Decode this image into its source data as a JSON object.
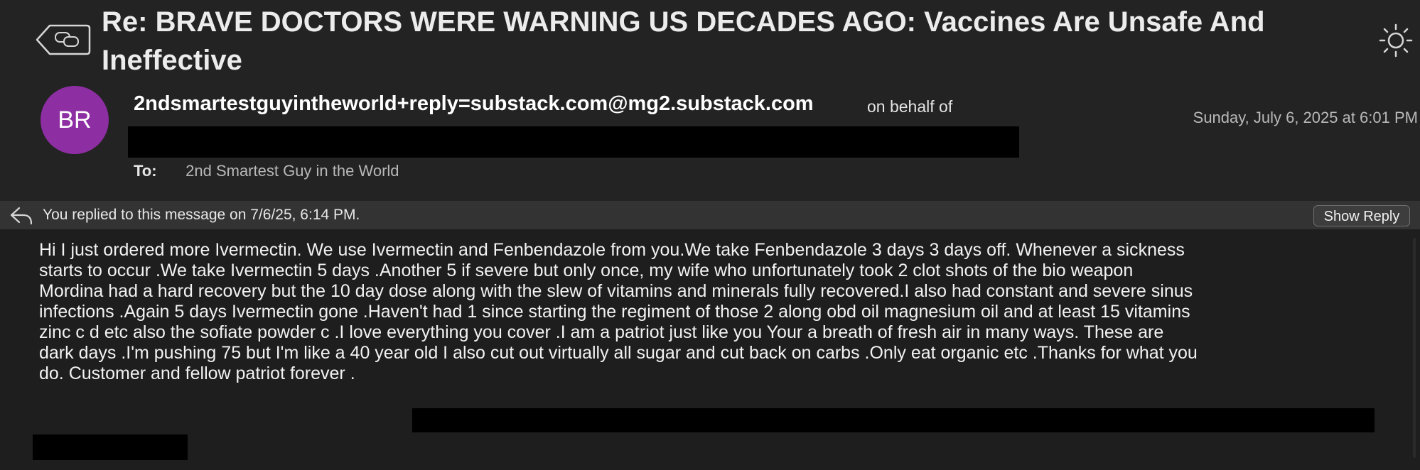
{
  "header": {
    "subject": "Re: BRAVE DOCTORS WERE WARNING US DECADES AGO: Vaccines Are Unsafe And Ineffective",
    "back_icon": "back-speech-bubbles-icon",
    "appearance_icon": "sun-icon"
  },
  "sender": {
    "avatar_initials": "BR",
    "avatar_color": "#8e2ea3",
    "address": "2ndsmartestguyintheworld+reply=substack.com@mg2.substack.com",
    "on_behalf_of": "on behalf of",
    "date": "Sunday, July 6, 2025 at 6:01 PM",
    "to_label": "To:",
    "to_value": "2nd Smartest Guy in the World"
  },
  "reply_bar": {
    "icon": "reply-arrow-icon",
    "text": "You replied to this message on 7/6/25, 6:14 PM.",
    "button_label": "Show Reply"
  },
  "message": {
    "lines": [
      "Hi I just ordered more Ivermectin. We use Ivermectin and Fenbendazole from you.We  take Fenbendazole 3 days 3 days off. Whenever a sickness",
      "starts  to occur .We take Ivermectin 5 days .Another 5 if severe but only once, my  wife who unfortunately took 2 clot shots of the  bio  weapon",
      "Mordina had a hard recovery but the 10 day dose along with  the slew of vitamins and minerals fully recovered.I also had constant and severe sinus",
      "infections .Again 5 days Ivermectin gone .Haven't had 1  since starting the regiment of those 2 along obd oil magnesium oil and at least 15 vitamins",
      "zinc c d etc also the sofiate powder c .I love everything you cover .I am a patriot just like you  Your  a breath of fresh air in many ways. These are",
      "dark days .I'm pushing 75 but I'm like a 40 year old  I also cut out virtually all sugar and cut back on carbs .Only eat organic  etc .Thanks for what you",
      "do. Customer and fellow patriot forever ."
    ]
  }
}
